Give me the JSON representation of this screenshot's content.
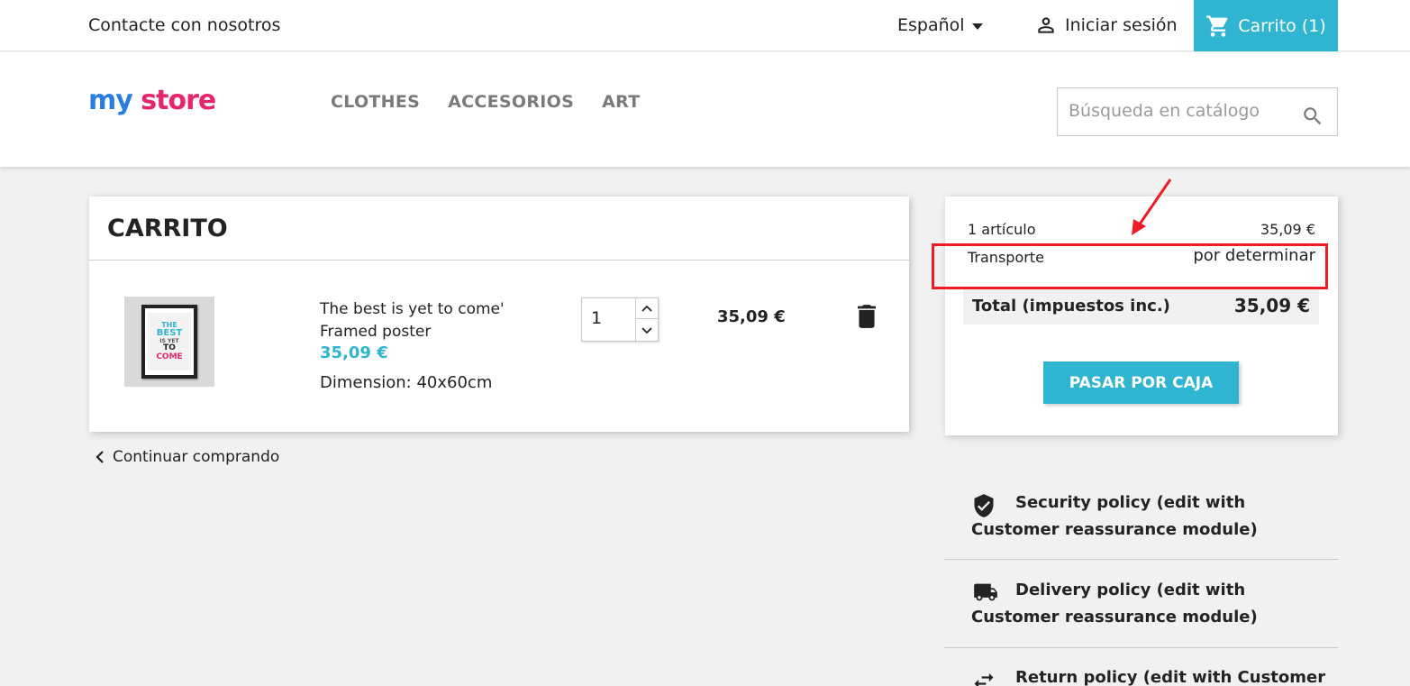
{
  "topbar": {
    "contact": "Contacte con nosotros",
    "language": "Español",
    "login": "Iniciar sesión",
    "cart": "Carrito (1)"
  },
  "header": {
    "logo": {
      "my": "my",
      "store": "store"
    },
    "nav": [
      "CLOTHES",
      "ACCESORIOS",
      "ART"
    ],
    "search_placeholder": "Búsqueda en catálogo"
  },
  "cart": {
    "title": "CARRITO",
    "item": {
      "name": "The best is yet to come' Framed poster",
      "price": "35,09 €",
      "dimension": "Dimension: 40x60cm",
      "quantity": "1",
      "total": "35,09 €",
      "poster_text": [
        "THE",
        "BEST",
        "IS YET",
        "TO",
        "COME"
      ]
    },
    "continue": "Continuar comprando"
  },
  "summary": {
    "items_label": "1 artículo",
    "items_value": "35,09 €",
    "shipping_label": "Transporte",
    "shipping_value": "por determinar",
    "total_label": "Total (impuestos inc.)",
    "total_value": "35,09 €",
    "checkout": "PASAR POR CAJA"
  },
  "reassurance": [
    {
      "icon": "shield-check-icon",
      "text": "Security policy (edit with Customer reassurance module)"
    },
    {
      "icon": "truck-icon",
      "text": "Delivery policy (edit with Customer reassurance module)"
    },
    {
      "icon": "swap-arrows-icon",
      "text": "Return policy (edit with Customer reassurance module)"
    }
  ],
  "colors": {
    "accent": "#2fb5d2",
    "annotation": "#ee1c25",
    "text": "#232323",
    "nav": "#7a7a7a"
  }
}
